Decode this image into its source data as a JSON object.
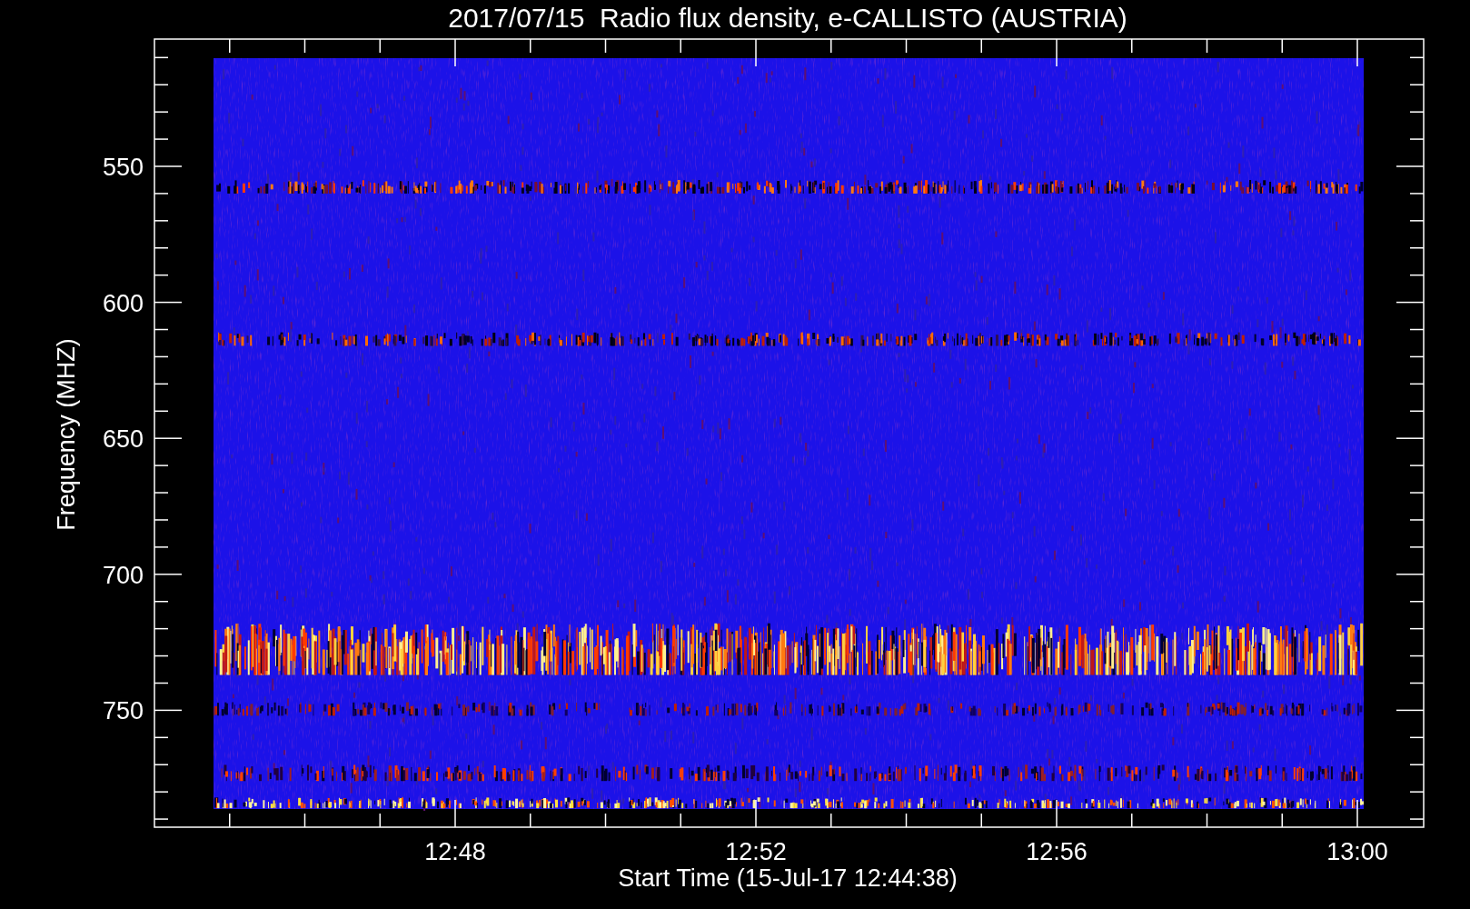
{
  "title": "2017/07/15  Radio flux density, e-CALLISTO (AUSTRIA)",
  "y_axis": {
    "label": "Frequency (MHZ)",
    "ticks": [
      "550",
      "600",
      "650",
      "700",
      "750"
    ]
  },
  "x_axis": {
    "label": "Start Time (15-Jul-17 12:44:38)",
    "ticks": [
      "12:48",
      "12:52",
      "12:56",
      "13:00"
    ]
  }
}
